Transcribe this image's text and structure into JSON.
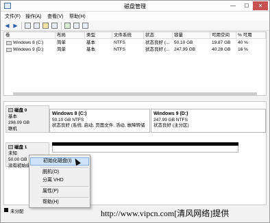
{
  "window": {
    "title": "磁盘管理",
    "controls": {
      "minimize": "—",
      "maximize": "☐",
      "close": "✕"
    }
  },
  "menubar": {
    "items": [
      "文件(F)",
      "操作(A)",
      "查看(V)",
      "帮助(H)"
    ]
  },
  "toolbar": {
    "back_icon": "arrow-left-icon",
    "forward_icon": "arrow-right-icon",
    "back_glyph": "◀",
    "forward_glyph": "▶"
  },
  "volume_list": {
    "columns": [
      "卷",
      "布局",
      "类型",
      "文件系统",
      "状态",
      "容量",
      "可用空间",
      "% 可用"
    ],
    "rows": [
      [
        "Windows 8 (C:)",
        "简单",
        "基本",
        "NTFS",
        "状态良好 (...",
        "50.10 GB",
        "19.87 GB",
        "40 %"
      ],
      [
        "Windows 9 (D:)",
        "简单",
        "基本",
        "NTFS",
        "状态良好 (...",
        "247.99 GB",
        "40.28 GB",
        "16 %"
      ]
    ]
  },
  "disks": [
    {
      "name": "磁盘 0",
      "type": "基本",
      "size": "298.09 GB",
      "status": "联机",
      "partitions": [
        {
          "name": "Windows 8  (C:)",
          "size": "50.10 GB NTFS",
          "status": "状态良好 (系统, 启动, 页面文件, 活动, 故障转储"
        },
        {
          "name": "Windows 9  (D:)",
          "size": "247.99 GB NTFS",
          "status": "状态良好 (主分区)"
        }
      ]
    },
    {
      "name": "磁盘 1",
      "type": "未知",
      "size": "50.00 GB",
      "status": "没有初始化"
    }
  ],
  "legend": {
    "label": "未分配",
    "color": "#0b0b0b"
  },
  "context_menu": {
    "items": [
      "初始化磁盘(I)",
      "脱机(O)",
      "分离 VHD",
      "属性(P)",
      "帮助(H)"
    ],
    "highlighted": "初始化磁盘(I)"
  },
  "watermark": "http://www.vipcn.com[清风网络]提供",
  "colors": {
    "partition_header": "#1f2a7c",
    "unallocated": "#0b0b0b",
    "highlight": "#cfe3f8"
  }
}
